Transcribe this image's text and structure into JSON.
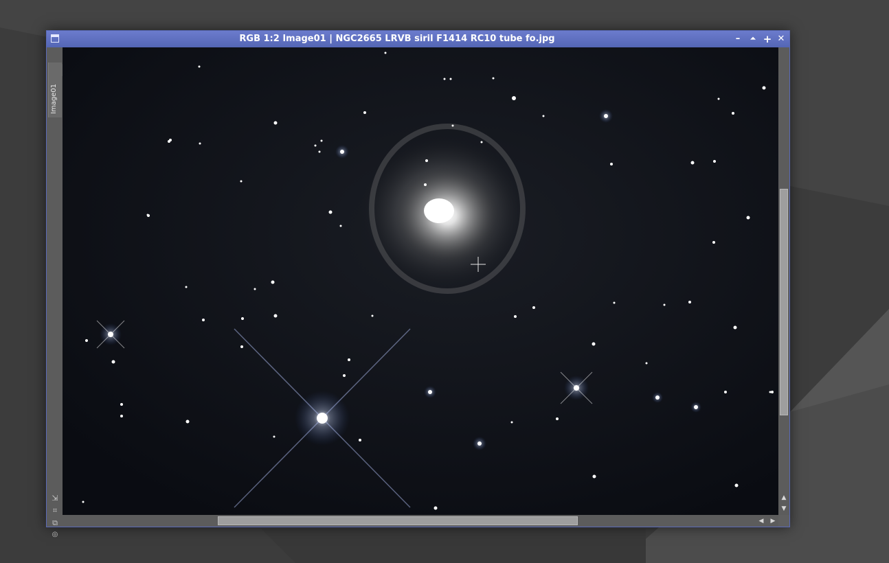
{
  "window": {
    "title": "RGB 1:2 Image01 | NGC2665 LRVB siril F1414 RC10 tube fo.jpg",
    "tab_label": "Image01",
    "buttons": {
      "minimize": "–",
      "shade": "⏶",
      "maximize": "+",
      "close": "✕"
    },
    "side_tools": [
      "arrow-icon",
      "fit-icon",
      "clone-icon",
      "settings-icon"
    ],
    "scroll_arrows": {
      "up": "▲",
      "down": "▼",
      "left": "◀",
      "right": "▶"
    }
  },
  "colors": {
    "titlebar": "#5a6ab8",
    "desktop": "#3d3d3d",
    "sky": "#0c0f15"
  }
}
